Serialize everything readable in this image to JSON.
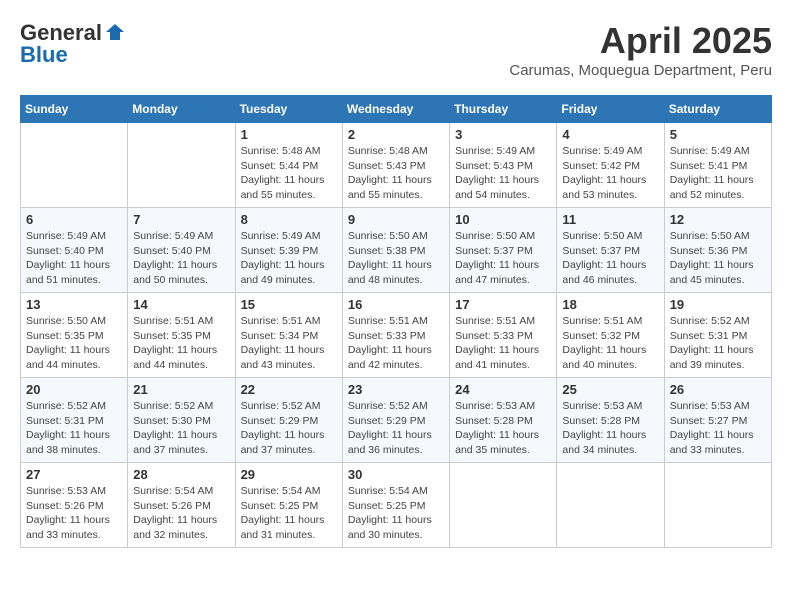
{
  "header": {
    "logo_general": "General",
    "logo_blue": "Blue",
    "month_title": "April 2025",
    "location": "Carumas, Moquegua Department, Peru"
  },
  "days_of_week": [
    "Sunday",
    "Monday",
    "Tuesday",
    "Wednesday",
    "Thursday",
    "Friday",
    "Saturday"
  ],
  "weeks": [
    [
      {
        "day": "",
        "info": ""
      },
      {
        "day": "",
        "info": ""
      },
      {
        "day": "1",
        "info": "Sunrise: 5:48 AM\nSunset: 5:44 PM\nDaylight: 11 hours and 55 minutes."
      },
      {
        "day": "2",
        "info": "Sunrise: 5:48 AM\nSunset: 5:43 PM\nDaylight: 11 hours and 55 minutes."
      },
      {
        "day": "3",
        "info": "Sunrise: 5:49 AM\nSunset: 5:43 PM\nDaylight: 11 hours and 54 minutes."
      },
      {
        "day": "4",
        "info": "Sunrise: 5:49 AM\nSunset: 5:42 PM\nDaylight: 11 hours and 53 minutes."
      },
      {
        "day": "5",
        "info": "Sunrise: 5:49 AM\nSunset: 5:41 PM\nDaylight: 11 hours and 52 minutes."
      }
    ],
    [
      {
        "day": "6",
        "info": "Sunrise: 5:49 AM\nSunset: 5:40 PM\nDaylight: 11 hours and 51 minutes."
      },
      {
        "day": "7",
        "info": "Sunrise: 5:49 AM\nSunset: 5:40 PM\nDaylight: 11 hours and 50 minutes."
      },
      {
        "day": "8",
        "info": "Sunrise: 5:49 AM\nSunset: 5:39 PM\nDaylight: 11 hours and 49 minutes."
      },
      {
        "day": "9",
        "info": "Sunrise: 5:50 AM\nSunset: 5:38 PM\nDaylight: 11 hours and 48 minutes."
      },
      {
        "day": "10",
        "info": "Sunrise: 5:50 AM\nSunset: 5:37 PM\nDaylight: 11 hours and 47 minutes."
      },
      {
        "day": "11",
        "info": "Sunrise: 5:50 AM\nSunset: 5:37 PM\nDaylight: 11 hours and 46 minutes."
      },
      {
        "day": "12",
        "info": "Sunrise: 5:50 AM\nSunset: 5:36 PM\nDaylight: 11 hours and 45 minutes."
      }
    ],
    [
      {
        "day": "13",
        "info": "Sunrise: 5:50 AM\nSunset: 5:35 PM\nDaylight: 11 hours and 44 minutes."
      },
      {
        "day": "14",
        "info": "Sunrise: 5:51 AM\nSunset: 5:35 PM\nDaylight: 11 hours and 44 minutes."
      },
      {
        "day": "15",
        "info": "Sunrise: 5:51 AM\nSunset: 5:34 PM\nDaylight: 11 hours and 43 minutes."
      },
      {
        "day": "16",
        "info": "Sunrise: 5:51 AM\nSunset: 5:33 PM\nDaylight: 11 hours and 42 minutes."
      },
      {
        "day": "17",
        "info": "Sunrise: 5:51 AM\nSunset: 5:33 PM\nDaylight: 11 hours and 41 minutes."
      },
      {
        "day": "18",
        "info": "Sunrise: 5:51 AM\nSunset: 5:32 PM\nDaylight: 11 hours and 40 minutes."
      },
      {
        "day": "19",
        "info": "Sunrise: 5:52 AM\nSunset: 5:31 PM\nDaylight: 11 hours and 39 minutes."
      }
    ],
    [
      {
        "day": "20",
        "info": "Sunrise: 5:52 AM\nSunset: 5:31 PM\nDaylight: 11 hours and 38 minutes."
      },
      {
        "day": "21",
        "info": "Sunrise: 5:52 AM\nSunset: 5:30 PM\nDaylight: 11 hours and 37 minutes."
      },
      {
        "day": "22",
        "info": "Sunrise: 5:52 AM\nSunset: 5:29 PM\nDaylight: 11 hours and 37 minutes."
      },
      {
        "day": "23",
        "info": "Sunrise: 5:52 AM\nSunset: 5:29 PM\nDaylight: 11 hours and 36 minutes."
      },
      {
        "day": "24",
        "info": "Sunrise: 5:53 AM\nSunset: 5:28 PM\nDaylight: 11 hours and 35 minutes."
      },
      {
        "day": "25",
        "info": "Sunrise: 5:53 AM\nSunset: 5:28 PM\nDaylight: 11 hours and 34 minutes."
      },
      {
        "day": "26",
        "info": "Sunrise: 5:53 AM\nSunset: 5:27 PM\nDaylight: 11 hours and 33 minutes."
      }
    ],
    [
      {
        "day": "27",
        "info": "Sunrise: 5:53 AM\nSunset: 5:26 PM\nDaylight: 11 hours and 33 minutes."
      },
      {
        "day": "28",
        "info": "Sunrise: 5:54 AM\nSunset: 5:26 PM\nDaylight: 11 hours and 32 minutes."
      },
      {
        "day": "29",
        "info": "Sunrise: 5:54 AM\nSunset: 5:25 PM\nDaylight: 11 hours and 31 minutes."
      },
      {
        "day": "30",
        "info": "Sunrise: 5:54 AM\nSunset: 5:25 PM\nDaylight: 11 hours and 30 minutes."
      },
      {
        "day": "",
        "info": ""
      },
      {
        "day": "",
        "info": ""
      },
      {
        "day": "",
        "info": ""
      }
    ]
  ]
}
